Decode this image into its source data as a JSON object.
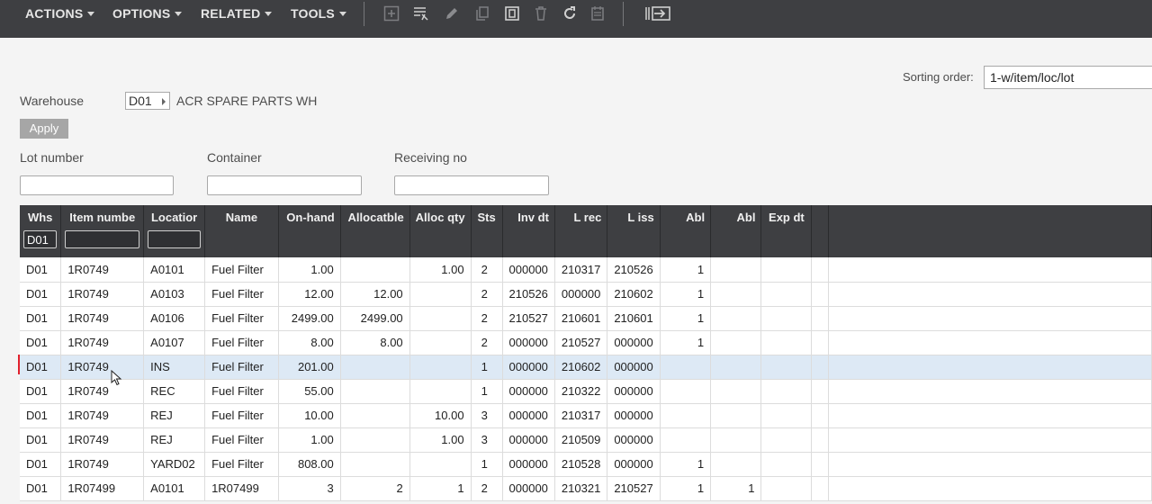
{
  "menus": [
    {
      "label": "ACTIONS"
    },
    {
      "label": "OPTIONS"
    },
    {
      "label": "RELATED"
    },
    {
      "label": "TOOLS"
    }
  ],
  "toolbar_icons": [
    "add-icon",
    "filter-list-icon",
    "edit-icon",
    "copy-icon",
    "duplicate-icon",
    "delete-icon",
    "refresh-icon",
    "calendar-icon",
    "navigate-icon"
  ],
  "sorting": {
    "label": "Sorting order:",
    "value": "1-w/item/loc/lot"
  },
  "warehouse": {
    "label": "Warehouse",
    "code": "D01",
    "name": "ACR SPARE PARTS WH"
  },
  "apply_label": "Apply",
  "filters": {
    "lot_label": "Lot number",
    "container_label": "Container",
    "receiving_label": "Receiving no",
    "lot_value": "",
    "container_value": "",
    "receiving_value": ""
  },
  "grid": {
    "columns": [
      {
        "label": "Whs",
        "filter": "D01"
      },
      {
        "label": "Item numbe",
        "filter": ""
      },
      {
        "label": "Locatior",
        "filter": ""
      },
      {
        "label": "Name"
      },
      {
        "label": "On-hand"
      },
      {
        "label": "Allocatble"
      },
      {
        "label": "Alloc qty"
      },
      {
        "label": "Sts"
      },
      {
        "label": "Inv dt"
      },
      {
        "label": "L rec"
      },
      {
        "label": "L iss"
      },
      {
        "label": "Abl"
      },
      {
        "label": "Abl"
      },
      {
        "label": "Exp dt"
      },
      {
        "label": ""
      }
    ],
    "rows": [
      [
        "D01",
        "1R0749",
        "A0101",
        "Fuel Filter",
        "1.00",
        "",
        "1.00",
        "2",
        "000000",
        "210317",
        "210526",
        "1",
        "",
        "",
        ""
      ],
      [
        "D01",
        "1R0749",
        "A0103",
        "Fuel Filter",
        "12.00",
        "12.00",
        "",
        "2",
        "210526",
        "000000",
        "210602",
        "1",
        "",
        "",
        ""
      ],
      [
        "D01",
        "1R0749",
        "A0106",
        "Fuel Filter",
        "2499.00",
        "2499.00",
        "",
        "2",
        "210527",
        "210601",
        "210601",
        "1",
        "",
        "",
        ""
      ],
      [
        "D01",
        "1R0749",
        "A0107",
        "Fuel Filter",
        "8.00",
        "8.00",
        "",
        "2",
        "000000",
        "210527",
        "000000",
        "1",
        "",
        "",
        ""
      ],
      [
        "D01",
        "1R0749",
        "INS",
        "Fuel Filter",
        "201.00",
        "",
        "",
        "1",
        "000000",
        "210602",
        "000000",
        "",
        "",
        "",
        ""
      ],
      [
        "D01",
        "1R0749",
        "REC",
        "Fuel Filter",
        "55.00",
        "",
        "",
        "1",
        "000000",
        "210322",
        "000000",
        "",
        "",
        "",
        ""
      ],
      [
        "D01",
        "1R0749",
        "REJ",
        "Fuel Filter",
        "10.00",
        "",
        "10.00",
        "3",
        "000000",
        "210317",
        "000000",
        "",
        "",
        "",
        ""
      ],
      [
        "D01",
        "1R0749",
        "REJ",
        "Fuel Filter",
        "1.00",
        "",
        "1.00",
        "3",
        "000000",
        "210509",
        "000000",
        "",
        "",
        "",
        ""
      ],
      [
        "D01",
        "1R0749",
        "YARD02",
        "Fuel Filter",
        "808.00",
        "",
        "",
        "1",
        "000000",
        "210528",
        "000000",
        "1",
        "",
        "",
        ""
      ],
      [
        "D01",
        "1R07499",
        "A0101",
        "1R07499",
        "3",
        "2",
        "1",
        "2",
        "000000",
        "210321",
        "210527",
        "1",
        "1",
        "",
        ""
      ]
    ],
    "selected_row": 4
  }
}
